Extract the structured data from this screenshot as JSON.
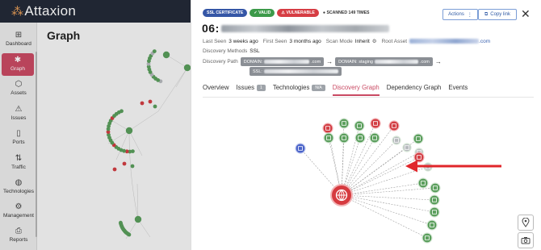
{
  "app": {
    "logo_text": "Attaxion",
    "page_title": "Graph"
  },
  "sidebar": {
    "items": [
      {
        "label": "Dashboard",
        "icon": "dashboard-icon",
        "active": false
      },
      {
        "label": "Graph",
        "icon": "graph-icon",
        "active": true
      },
      {
        "label": "Assets",
        "icon": "assets-icon",
        "active": false
      },
      {
        "label": "Issues",
        "icon": "issues-icon",
        "active": false
      },
      {
        "label": "Ports",
        "icon": "ports-icon",
        "active": false
      },
      {
        "label": "Traffic",
        "icon": "traffic-icon",
        "active": false
      },
      {
        "label": "Technologies",
        "icon": "technologies-icon",
        "active": false
      },
      {
        "label": "Management",
        "icon": "management-icon",
        "active": false
      },
      {
        "label": "Reports",
        "icon": "reports-icon",
        "active": false
      }
    ]
  },
  "drawer": {
    "badges": [
      {
        "label": "SSL CERTIFICATE",
        "color": "#3556a6"
      },
      {
        "label": "VALID",
        "color": "#3c9a4a"
      },
      {
        "label": "VULNERABLE",
        "color": "#d63d44"
      },
      {
        "label": "SCANNED 149 TIMES",
        "color": "#333333"
      }
    ],
    "actions_label": "Actions",
    "copy_link_label": "Copy link",
    "title_prefix": "06:",
    "last_seen_label": "Last Seen",
    "last_seen_value": "3 weeks ago",
    "first_seen_label": "First Seen",
    "first_seen_value": "3 months ago",
    "scan_mode_label": "Scan Mode",
    "scan_mode_value": "Inherit",
    "root_asset_label": "Root Asset",
    "root_asset_suffix": ".com",
    "discovery_methods_label": "Discovery Methods",
    "discovery_methods_value": "SSL",
    "discovery_path_label": "Discovery Path",
    "path": [
      {
        "prefix": "DOMAIN:",
        "suffix": ".com"
      },
      {
        "prefix": "DOMAIN: staging",
        "suffix": ".com"
      },
      {
        "prefix": "SSL:",
        "suffix": ""
      }
    ],
    "tabs": [
      {
        "label": "Overview",
        "count": "",
        "active": false
      },
      {
        "label": "Issues",
        "count": "1",
        "active": false
      },
      {
        "label": "Technologies",
        "count": "N/A",
        "active": false
      },
      {
        "label": "Discovery Graph",
        "count": "",
        "active": true
      },
      {
        "label": "Dependency Graph",
        "count": "",
        "active": false
      },
      {
        "label": "Events",
        "count": "",
        "active": false
      }
    ]
  },
  "colors": {
    "accent": "#c94a63",
    "node_green": "#5a9e5c",
    "node_red": "#d23d43",
    "node_grey": "#b6b9bd",
    "node_blue": "#4a63c9",
    "center": "#d63a3f",
    "annotation_arrow": "#e0262b"
  }
}
